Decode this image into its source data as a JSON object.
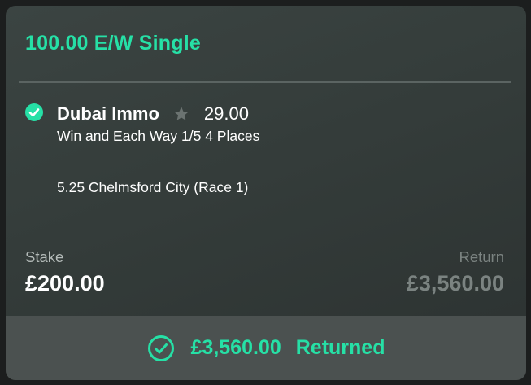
{
  "bet": {
    "title": "100.00 E/W Single",
    "selection": {
      "name": "Dubai Immo",
      "odds": "29.00",
      "market": "Win and Each Way 1/5 4 Places",
      "event": "5.25 Chelmsford City (Race 1)",
      "status_icon": "check-circle-filled-icon",
      "favourite_icon": "star-icon"
    },
    "stake": {
      "label": "Stake",
      "value": "£200.00"
    },
    "return": {
      "label": "Return",
      "value": "£3,560.00"
    },
    "footer": {
      "icon": "check-circle-outline-icon",
      "amount": "£3,560.00",
      "status": "Returned"
    }
  },
  "colors": {
    "accent": "#26e0a6",
    "card_background": "#353d3b",
    "footer_background": "#4b5150",
    "muted_text": "#7b8381",
    "star": "#6b7371"
  }
}
